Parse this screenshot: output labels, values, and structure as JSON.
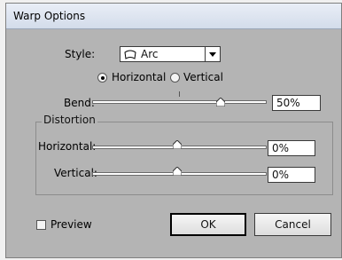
{
  "dialog": {
    "title": "Warp Options"
  },
  "style": {
    "label": "Style:",
    "selected": "Arc",
    "icon": "arc-warp-icon"
  },
  "orientation": {
    "options": [
      "Horizontal",
      "Vertical"
    ],
    "selected": "Horizontal"
  },
  "bend": {
    "label": "Bend:",
    "value": "50%",
    "fraction": 0.75
  },
  "distortion": {
    "group_label": "Distortion",
    "horizontal": {
      "label": "Horizontal:",
      "value": "0%",
      "fraction": 0.5
    },
    "vertical": {
      "label": "Vertical:",
      "value": "0%",
      "fraction": 0.5
    }
  },
  "preview": {
    "label": "Preview",
    "checked": false
  },
  "buttons": {
    "ok": "OK",
    "cancel": "Cancel"
  }
}
